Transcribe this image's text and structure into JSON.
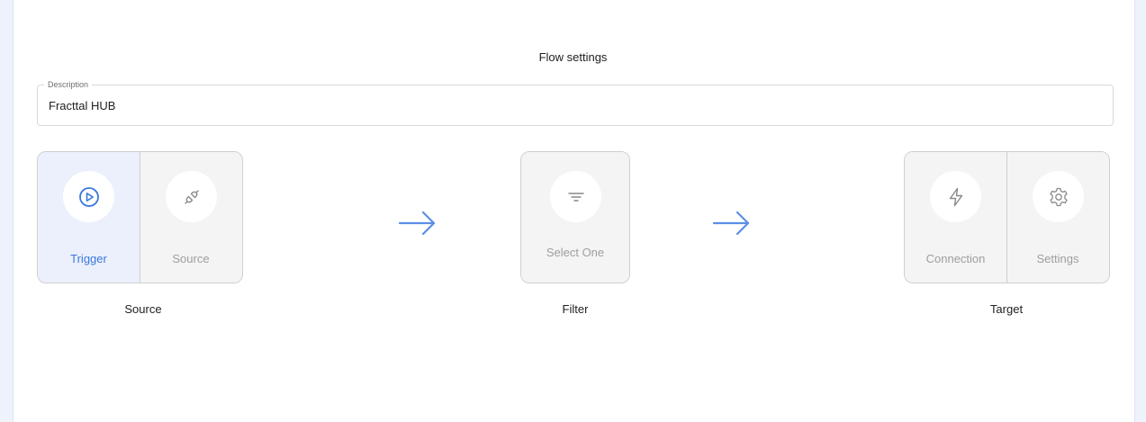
{
  "title": "Flow settings",
  "description": {
    "label": "Description",
    "value": "Fracttal HUB"
  },
  "colors": {
    "accent": "#3b78dc",
    "arrow": "#5b8fe6",
    "active_bg": "#ebf0fc",
    "inactive_bg": "#f4f4f4",
    "inactive_text": "#9e9e9e"
  },
  "steps": {
    "source": {
      "caption": "Source",
      "items": [
        {
          "label": "Trigger",
          "icon": "play-circle-icon",
          "active": true
        },
        {
          "label": "Source",
          "icon": "plug-icon",
          "active": false
        }
      ]
    },
    "filter": {
      "caption": "Filter",
      "items": [
        {
          "label": "Select One",
          "icon": "filter-lines-icon",
          "active": false
        }
      ]
    },
    "target": {
      "caption": "Target",
      "items": [
        {
          "label": "Connection",
          "icon": "lightning-icon",
          "active": false
        },
        {
          "label": "Settings",
          "icon": "gear-icon",
          "active": false
        }
      ]
    }
  }
}
